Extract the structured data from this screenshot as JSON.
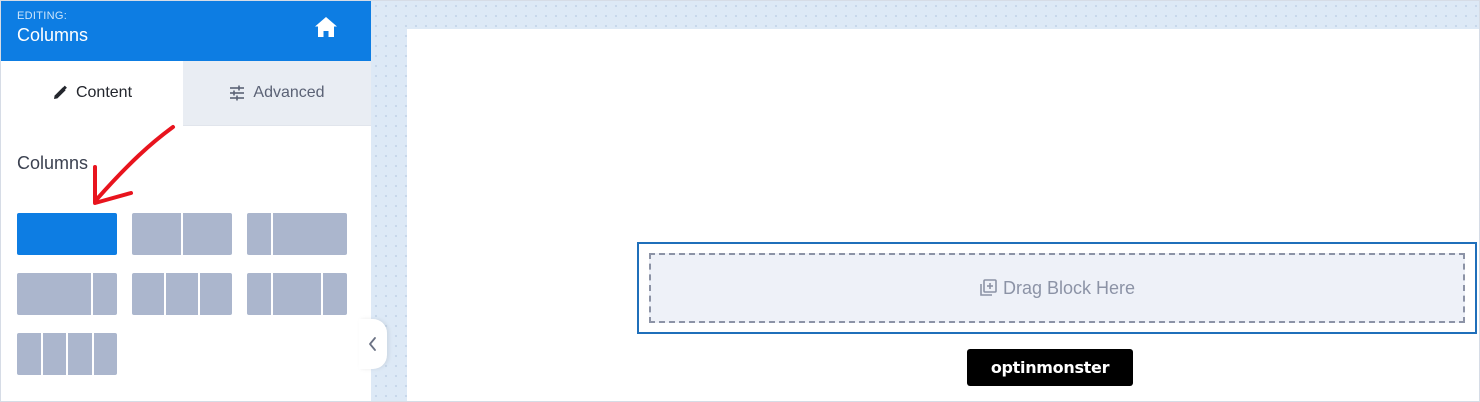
{
  "sidebar": {
    "header": {
      "eyebrow": "EDITING:",
      "title": "Columns",
      "home_icon": "home-icon"
    },
    "tabs": [
      {
        "label": "Content",
        "icon": "pencil-icon",
        "active": true
      },
      {
        "label": "Advanced",
        "icon": "sliders-icon",
        "active": false
      }
    ],
    "section_label": "Columns",
    "layouts": [
      {
        "name": "1 column",
        "active": true
      },
      {
        "name": "2 equal columns",
        "active": false
      },
      {
        "name": "1/4 + 3/4",
        "active": false
      },
      {
        "name": "3/4 + 1/4",
        "active": false
      },
      {
        "name": "3 equal columns",
        "active": false
      },
      {
        "name": "1/4 + 1/2 + 1/4",
        "active": false
      },
      {
        "name": "4 equal columns",
        "active": false
      }
    ],
    "collapse_icon": "chevron-left-icon"
  },
  "canvas": {
    "drop_zone_label": "Drag Block Here",
    "drop_zone_icon": "add-block-icon",
    "brand_text": "optinmonster"
  },
  "colors": {
    "accent": "#0d7de3",
    "inactive_layout": "#abb6cd",
    "block_border": "#1f6fba",
    "annotation_arrow": "#e8141e"
  }
}
